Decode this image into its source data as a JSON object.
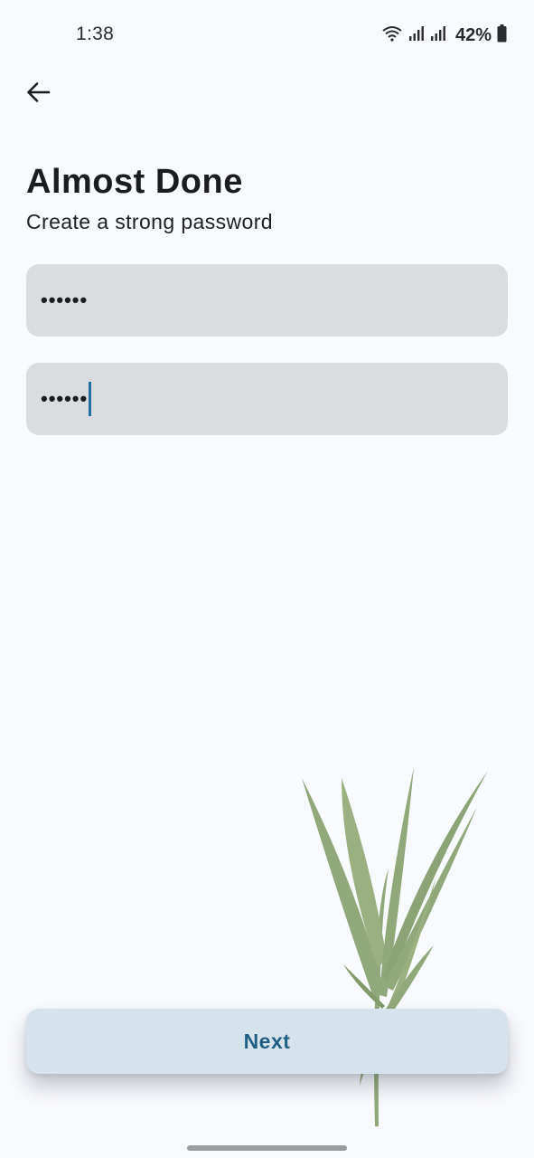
{
  "status_bar": {
    "time": "1:38",
    "battery": "42%",
    "icons": [
      "wifi-icon",
      "signal-icon",
      "signal-icon",
      "battery-icon"
    ]
  },
  "back": {
    "icon": "arrow-left-icon"
  },
  "header": {
    "title": "Almost Done",
    "subtitle": "Create a strong password"
  },
  "form": {
    "password": {
      "value": "••••••"
    },
    "confirm_password": {
      "value": "••••••"
    }
  },
  "next_button": {
    "label": "Next"
  },
  "colors": {
    "background": "#f9fafe",
    "field": "#dadcdf",
    "button": "#d7e3ec",
    "button_text": "#1f5f86",
    "caret": "#1e6fa3",
    "plant": "#7f9a63"
  }
}
